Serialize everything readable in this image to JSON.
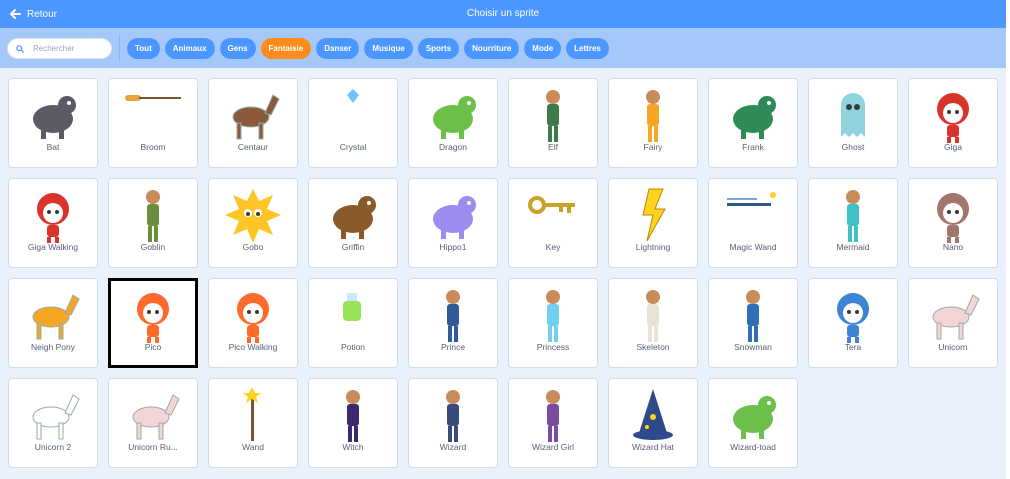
{
  "header": {
    "back_label": "Retour",
    "title": "Choisir un sprite"
  },
  "search": {
    "placeholder": "Rechercher"
  },
  "tags": [
    {
      "label": "Tout",
      "active": false
    },
    {
      "label": "Animaux",
      "active": false
    },
    {
      "label": "Gens",
      "active": false
    },
    {
      "label": "Fantaisie",
      "active": true
    },
    {
      "label": "Danser",
      "active": false
    },
    {
      "label": "Musique",
      "active": false
    },
    {
      "label": "Sports",
      "active": false
    },
    {
      "label": "Nourriture",
      "active": false
    },
    {
      "label": "Mode",
      "active": false
    },
    {
      "label": "Lettres",
      "active": false
    }
  ],
  "colors": {
    "primary": "#4c97ff",
    "active_tag": "#ff8c1a",
    "filter_bar": "#a5c8fb",
    "grid_bg": "#e9f1fc",
    "label": "#575e75"
  },
  "selected_sprite": "Pico",
  "sprites": [
    {
      "name": "Bat",
      "icon": "bat",
      "color": "#5b5b66"
    },
    {
      "name": "Broom",
      "icon": "broom",
      "color": "#e8a33a"
    },
    {
      "name": "Centaur",
      "icon": "centaur",
      "color": "#8a5a3b"
    },
    {
      "name": "Crystal",
      "icon": "crystal",
      "color": "#6fc3ff"
    },
    {
      "name": "Dragon",
      "icon": "dragon",
      "color": "#6cc04a"
    },
    {
      "name": "Elf",
      "icon": "elf",
      "color": "#3f7a4a"
    },
    {
      "name": "Fairy",
      "icon": "fairy",
      "color": "#f5a623"
    },
    {
      "name": "Frank",
      "icon": "frank",
      "color": "#2e8b57"
    },
    {
      "name": "Ghost",
      "icon": "ghost",
      "color": "#8fd3df"
    },
    {
      "name": "Giga",
      "icon": "giga",
      "color": "#d9342b"
    },
    {
      "name": "Giga Walking",
      "icon": "giga-walking",
      "color": "#d9342b"
    },
    {
      "name": "Goblin",
      "icon": "goblin",
      "color": "#6b8e3d"
    },
    {
      "name": "Gobo",
      "icon": "gobo",
      "color": "#ffc425"
    },
    {
      "name": "Griffin",
      "icon": "griffin",
      "color": "#8b5a2b"
    },
    {
      "name": "Hippo1",
      "icon": "hippo",
      "color": "#9c8cf0"
    },
    {
      "name": "Key",
      "icon": "key",
      "color": "#c9a227"
    },
    {
      "name": "Lightning",
      "icon": "lightning",
      "color": "#ffd21f"
    },
    {
      "name": "Magic Wand",
      "icon": "magic-wand",
      "color": "#2f5b8a"
    },
    {
      "name": "Mermaid",
      "icon": "mermaid",
      "color": "#3fc1c9"
    },
    {
      "name": "Nano",
      "icon": "nano",
      "color": "#a0776a"
    },
    {
      "name": "Neigh Pony",
      "icon": "neigh-pony",
      "color": "#f5a623"
    },
    {
      "name": "Pico",
      "icon": "pico",
      "color": "#ff6a2b"
    },
    {
      "name": "Pico Walking",
      "icon": "pico-walking",
      "color": "#ff6a2b"
    },
    {
      "name": "Potion",
      "icon": "potion",
      "color": "#9be35a"
    },
    {
      "name": "Prince",
      "icon": "prince",
      "color": "#2f5b9a"
    },
    {
      "name": "Princess",
      "icon": "princess",
      "color": "#6fd0f0"
    },
    {
      "name": "Skeleton",
      "icon": "skeleton",
      "color": "#e8e3d3"
    },
    {
      "name": "Snowman",
      "icon": "snowman",
      "color": "#2f6fba"
    },
    {
      "name": "Tera",
      "icon": "tera",
      "color": "#3d84d6"
    },
    {
      "name": "Unicorn",
      "icon": "unicorn",
      "color": "#f3d5d5"
    },
    {
      "name": "Unicorn 2",
      "icon": "unicorn-2",
      "color": "#ffffff"
    },
    {
      "name": "Unicorn Ru...",
      "icon": "unicorn-running",
      "color": "#f3d5d5"
    },
    {
      "name": "Wand",
      "icon": "wand",
      "color": "#7a5230"
    },
    {
      "name": "Witch",
      "icon": "witch",
      "color": "#3b2a6b"
    },
    {
      "name": "Wizard",
      "icon": "wizard",
      "color": "#3b4a7a"
    },
    {
      "name": "Wizard Girl",
      "icon": "wizard-girl",
      "color": "#7b4ba0"
    },
    {
      "name": "Wizard Hat",
      "icon": "wizard-hat",
      "color": "#2f4a8a"
    },
    {
      "name": "Wizard-toad",
      "icon": "wizard-toad",
      "color": "#6cbf4a"
    }
  ]
}
